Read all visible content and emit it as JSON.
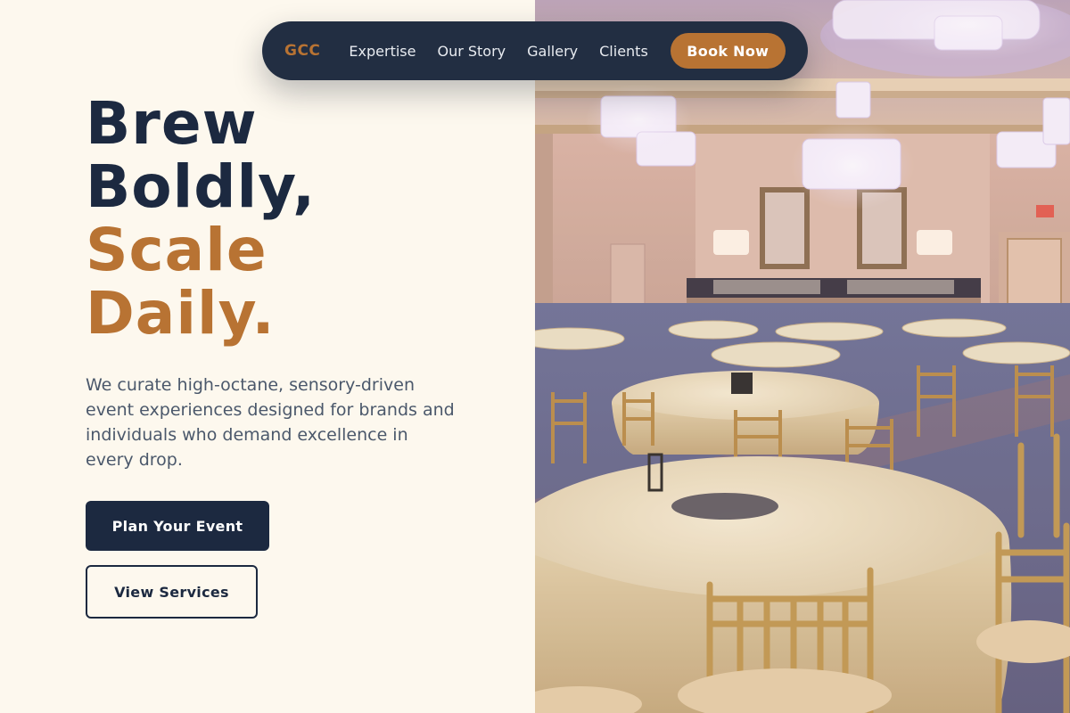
{
  "nav": {
    "logo": "GCC",
    "links": [
      "Expertise",
      "Our Story",
      "Gallery",
      "Clients"
    ],
    "cta": "Book Now"
  },
  "hero": {
    "headline_line1": "Brew",
    "headline_line2": "Boldly,",
    "headline_line3": "Scale",
    "headline_line4": "Daily.",
    "description": "We curate high-octane, sensory-driven event experiences designed for brands and individuals who demand excellence in every drop.",
    "primary_button": "Plan Your Event",
    "secondary_button": "View Services"
  },
  "image": {
    "subject": "ballroom-banquet-photo"
  },
  "colors": {
    "navy": "#1c2940",
    "copper": "#b87333",
    "cream": "#fdf8ee",
    "nav_bg": "#222e42"
  }
}
